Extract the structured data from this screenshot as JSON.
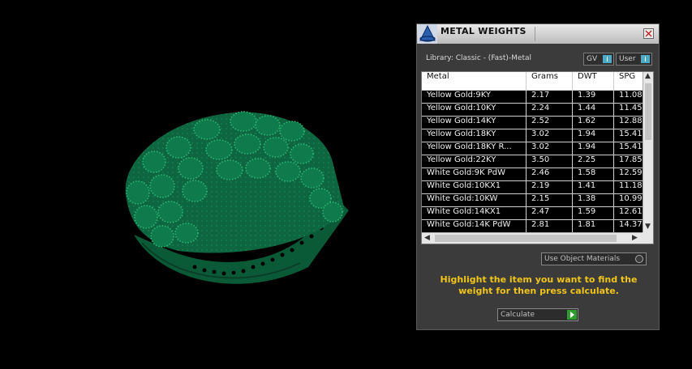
{
  "panel": {
    "title": "METAL WEIGHTS",
    "close_symbol": "✕",
    "library_label": "Library: Classic - (Fast)-Metal",
    "toggles": [
      {
        "label": "GV"
      },
      {
        "label": "User"
      }
    ]
  },
  "table": {
    "columns": [
      "Metal",
      "Grams",
      "DWT",
      "SPG"
    ],
    "rows": [
      {
        "metal": "Yellow Gold:9KY",
        "grams": "2.17",
        "dwt": "1.39",
        "spg": "11.08"
      },
      {
        "metal": "Yellow Gold:10KY",
        "grams": "2.24",
        "dwt": "1.44",
        "spg": "11.45"
      },
      {
        "metal": "Yellow Gold:14KY",
        "grams": "2.52",
        "dwt": "1.62",
        "spg": "12.88"
      },
      {
        "metal": "Yellow Gold:18KY",
        "grams": "3.02",
        "dwt": "1.94",
        "spg": "15.41"
      },
      {
        "metal": "Yellow Gold:18KY R...",
        "grams": "3.02",
        "dwt": "1.94",
        "spg": "15.41"
      },
      {
        "metal": "Yellow Gold:22KY",
        "grams": "3.50",
        "dwt": "2.25",
        "spg": "17.85"
      },
      {
        "metal": "White Gold:9K PdW",
        "grams": "2.46",
        "dwt": "1.58",
        "spg": "12.59"
      },
      {
        "metal": "White Gold:10KX1",
        "grams": "2.19",
        "dwt": "1.41",
        "spg": "11.18"
      },
      {
        "metal": "White Gold:10KW",
        "grams": "2.15",
        "dwt": "1.38",
        "spg": "10.99"
      },
      {
        "metal": "White Gold:14KX1",
        "grams": "2.47",
        "dwt": "1.59",
        "spg": "12.61"
      },
      {
        "metal": "White Gold:14K PdW",
        "grams": "2.81",
        "dwt": "1.81",
        "spg": "14.37"
      }
    ]
  },
  "use_object_materials": "Use Object Materials",
  "instructions": "Highlight the item you want to find the weight for then press calculate.",
  "calculate_label": "Calculate",
  "colors": {
    "ring": "#0e6b43",
    "accent_text": "#f0c419",
    "toggle_switch": "#4ea9c4",
    "calc_go": "#2e9c2e"
  }
}
